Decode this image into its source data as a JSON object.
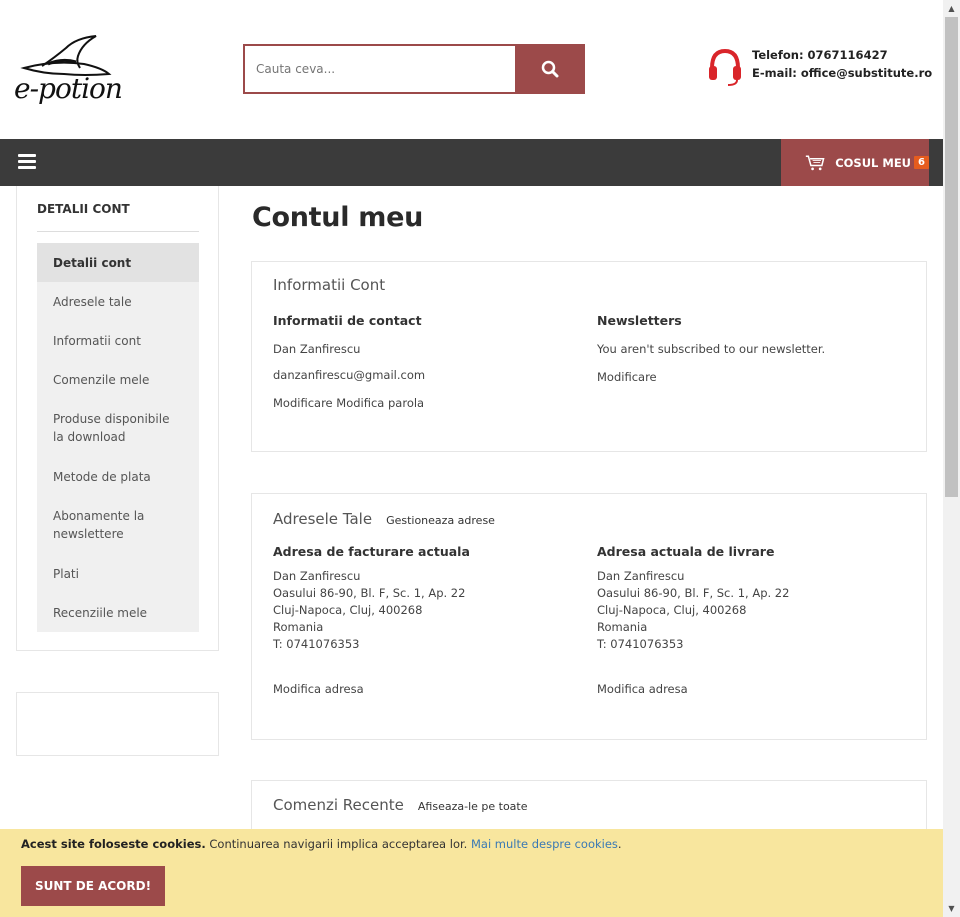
{
  "header": {
    "logo_text": "e-potion",
    "search_placeholder": "Cauta ceva...",
    "phone_line": "Telefon: 0767116427",
    "email_line": "E-mail: office@substitute.ro"
  },
  "navbar": {
    "cart_label": "COSUL MEU",
    "cart_count": "6"
  },
  "sidebar": {
    "title": "DETALII CONT",
    "items": [
      {
        "label": "Detalii cont",
        "active": true
      },
      {
        "label": "Adresele tale"
      },
      {
        "label": "Informatii cont"
      },
      {
        "label": "Comenzile mele"
      },
      {
        "label": "Produse disponibile la download"
      },
      {
        "label": "Metode de plata"
      },
      {
        "label": "Abonamente la newslettere"
      },
      {
        "label": "Plati"
      },
      {
        "label": "Recenziile mele"
      }
    ]
  },
  "main": {
    "page_title": "Contul meu",
    "account_info": {
      "title": "Informatii Cont",
      "contact_title": "Informatii de contact",
      "name": "Dan Zanfirescu",
      "email": "danzanfirescu@gmail.com",
      "edit_link": "Modificare",
      "change_password_link": "Modifica parola",
      "newsletter_title": "Newsletters",
      "newsletter_text": "You aren't subscribed to our newsletter.",
      "newsletter_edit": "Modificare"
    },
    "addresses": {
      "title": "Adresele Tale",
      "manage_link": "Gestioneaza adrese",
      "billing_title": "Adresa de facturare actuala",
      "shipping_title": "Adresa actuala de livrare",
      "billing_lines": [
        "Dan Zanfirescu",
        "Oasului 86-90, Bl. F, Sc. 1, Ap. 22",
        "Cluj-Napoca, Cluj, 400268",
        "Romania",
        "T: 0741076353"
      ],
      "shipping_lines": [
        "Dan Zanfirescu",
        "Oasului 86-90, Bl. F, Sc. 1, Ap. 22",
        "Cluj-Napoca, Cluj, 400268",
        "Romania",
        "T: 0741076353"
      ],
      "billing_edit": "Modifica adresa",
      "shipping_edit": "Modifica adresa"
    },
    "recent_orders": {
      "title": "Comenzi Recente",
      "view_all_link": "Afiseaza-le pe toate"
    }
  },
  "cookie": {
    "bold_text": "Acest site foloseste cookies.",
    "text": " Continuarea navigarii implica acceptarea lor. ",
    "link_text": "Mai multe despre cookies",
    "end_text": ".",
    "button_label": "SUNT DE ACORD!"
  },
  "colors": {
    "brand": "#9c4a4a",
    "navbar": "#3b3b3b",
    "cart_badge": "#e65c1e",
    "cookie_bg": "#f8e69e",
    "headset": "#d9252a"
  }
}
